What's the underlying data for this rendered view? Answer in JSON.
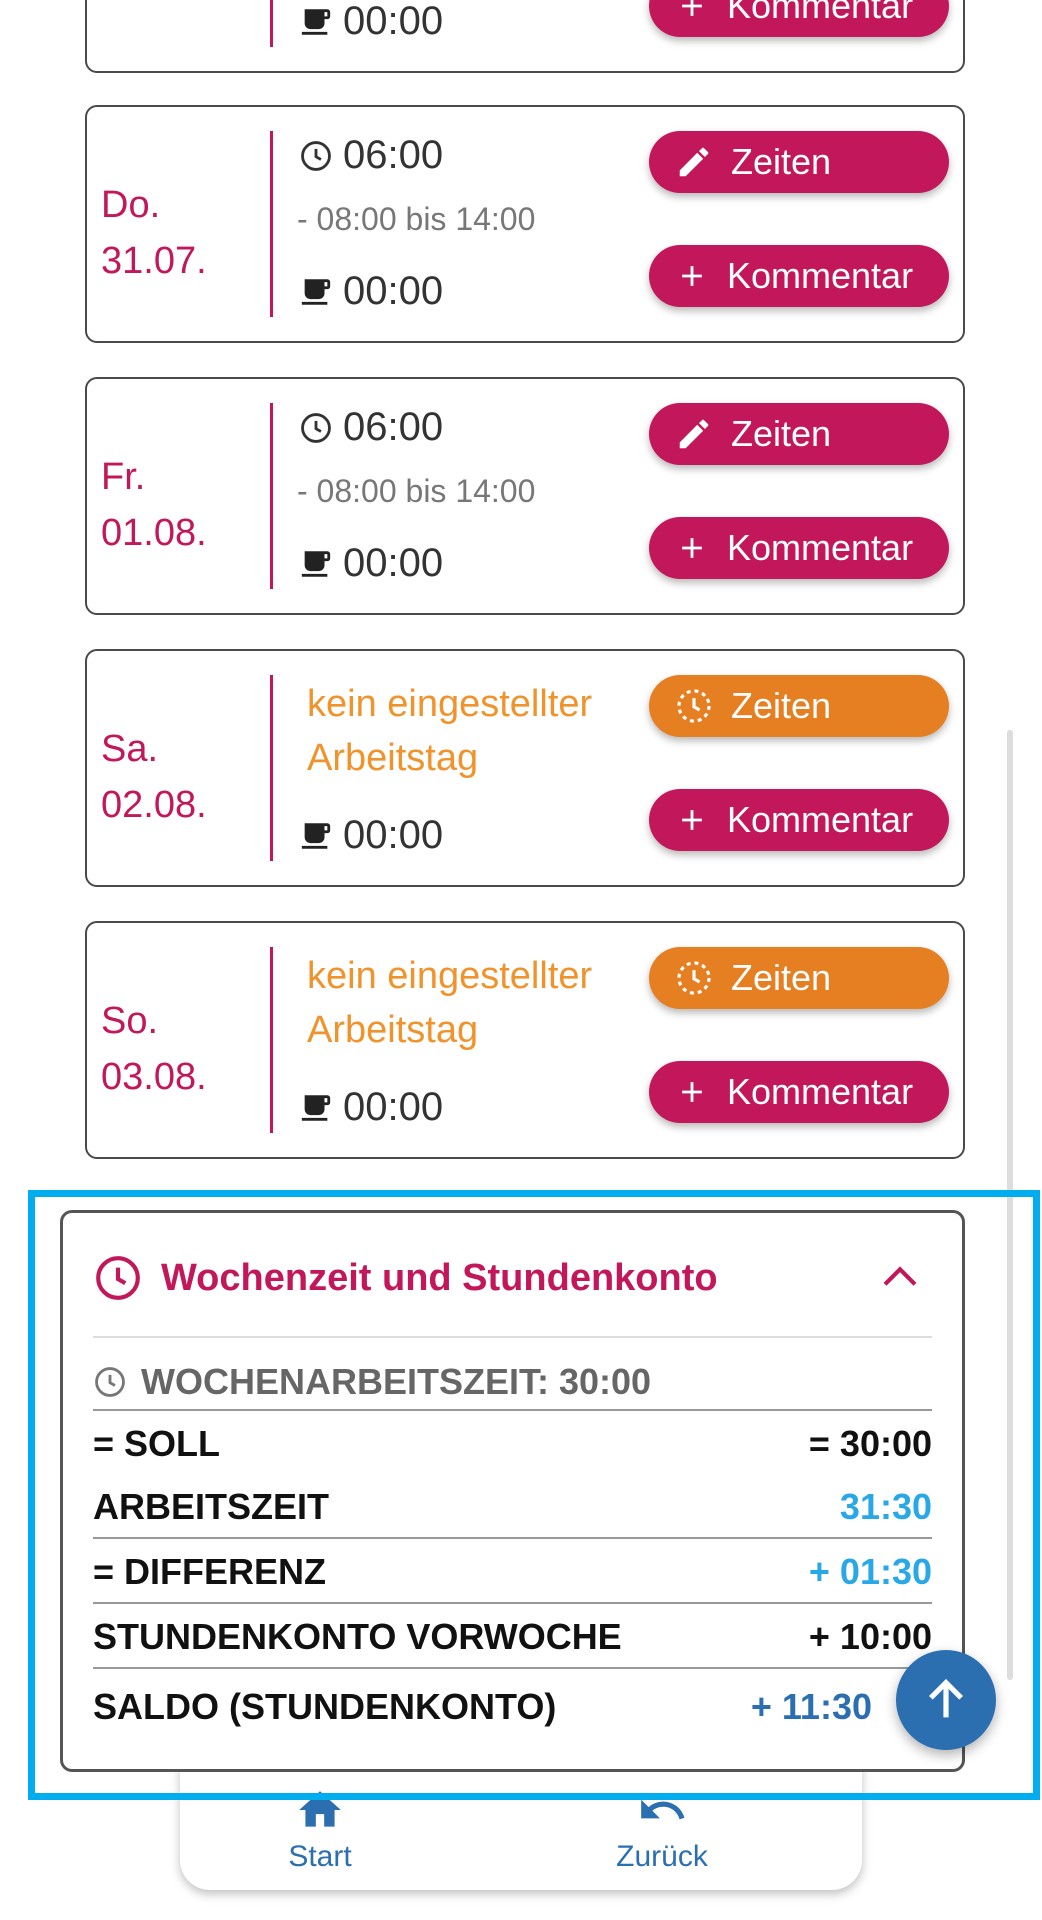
{
  "days": [
    {
      "id": "wed",
      "weekday": "",
      "date": "",
      "work_time": "",
      "range": "",
      "break_time": "00:00",
      "zeiten_label": "",
      "zeiten_state": "",
      "kommentar_label": "Kommentar"
    },
    {
      "id": "thu",
      "weekday": "Do.",
      "date": "31.07.",
      "work_time": "06:00",
      "range": "- 08:00 bis 14:00",
      "break_time": "00:00",
      "zeiten_label": "Zeiten",
      "zeiten_state": "edit",
      "kommentar_label": "Kommentar"
    },
    {
      "id": "fri",
      "weekday": "Fr.",
      "date": "01.08.",
      "work_time": "06:00",
      "range": "- 08:00 bis 14:00",
      "break_time": "00:00",
      "zeiten_label": "Zeiten",
      "zeiten_state": "edit",
      "kommentar_label": "Kommentar"
    },
    {
      "id": "sat",
      "weekday": "Sa.",
      "date": "02.08.",
      "status_line1": "kein eingestellter",
      "status_line2": "Arbeitstag",
      "break_time": "00:00",
      "zeiten_label": "Zeiten",
      "zeiten_state": "off",
      "kommentar_label": "Kommentar"
    },
    {
      "id": "sun",
      "weekday": "So.",
      "date": "03.08.",
      "status_line1": "kein eingestellter",
      "status_line2": "Arbeitstag",
      "break_time": "00:00",
      "zeiten_label": "Zeiten",
      "zeiten_state": "off",
      "kommentar_label": "Kommentar"
    }
  ],
  "summary": {
    "title": "Wochenzeit und Stundenkonto",
    "weekly_label": "WOCHENARBEITSZEIT: 30:00",
    "rows": [
      {
        "label": "= SOLL",
        "value": "= 30:00"
      },
      {
        "label": "ARBEITSZEIT",
        "value": "31:30"
      },
      {
        "label": "= DIFFERENZ",
        "value": "+ 01:30"
      },
      {
        "label": "STUNDENKONTO VORWOCHE",
        "value": "+ 10:00"
      },
      {
        "label": "SALDO (STUNDENKONTO)",
        "value": "+ 11:30"
      }
    ]
  },
  "nav": {
    "start": "Start",
    "back": "Zurück"
  },
  "colors": {
    "accent": "#c2185b",
    "orange": "#e67e22",
    "blue": "#2c6fb0",
    "highlight": "#00aeef"
  }
}
